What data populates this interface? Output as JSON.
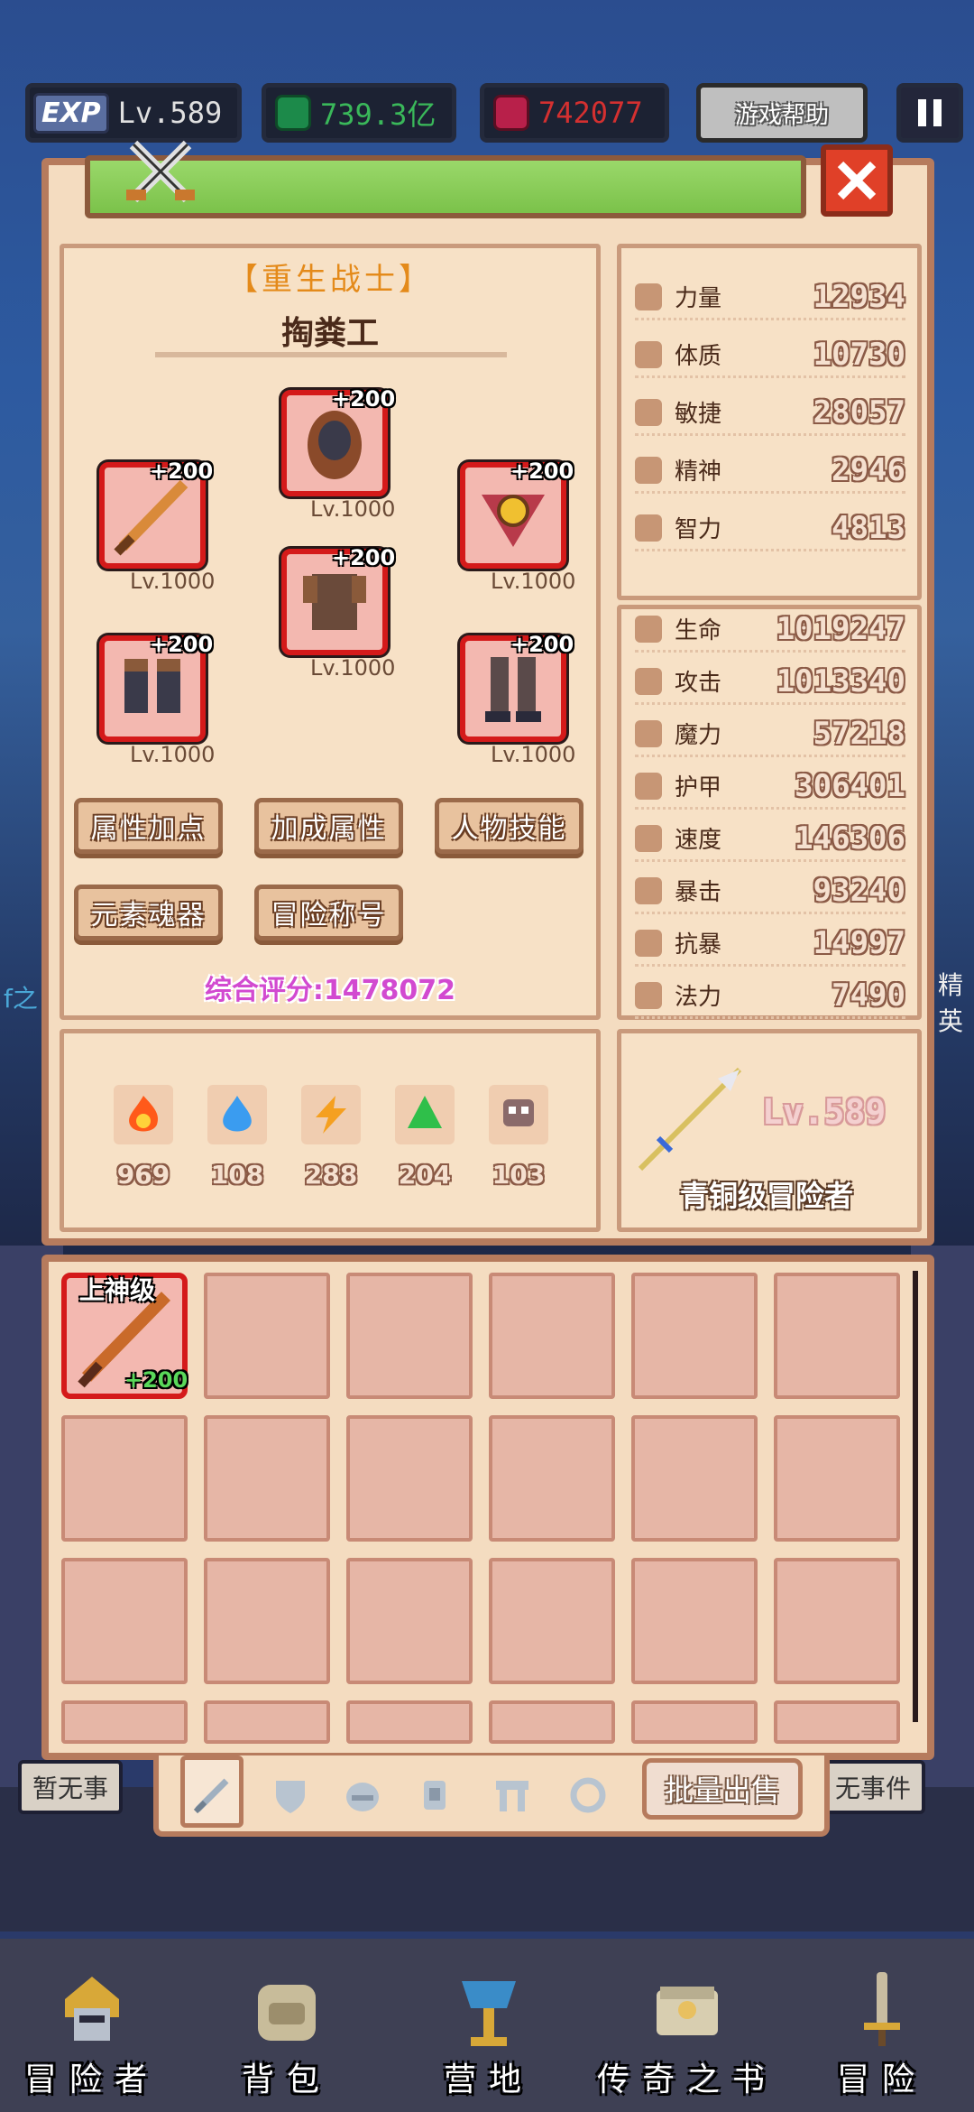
{
  "hud": {
    "exp_badge": "EXP",
    "level": "Lv.589",
    "gold": "739.3亿",
    "gems": "742077",
    "help": "游戏帮助"
  },
  "character": {
    "class_title": "【重生战士】",
    "name": "掏粪工",
    "score_label": "综合评分:",
    "score_value": "1478072"
  },
  "equipment": [
    {
      "plus": "+200",
      "level": "Lv.1000"
    },
    {
      "plus": "+200",
      "level": "Lv.1000"
    },
    {
      "plus": "+200",
      "level": "Lv.1000"
    },
    {
      "plus": "+200",
      "level": "Lv.1000"
    },
    {
      "plus": "+200",
      "level": "Lv.1000"
    },
    {
      "plus": "+200",
      "level": "Lv.1000"
    }
  ],
  "actions": {
    "attr_points": "属性加点",
    "bonus_attr": "加成属性",
    "char_skills": "人物技能",
    "element_soul": "元素魂器",
    "adventure_title": "冒险称号"
  },
  "base_stats": [
    {
      "label": "力量",
      "value": "12934",
      "icon": "strength-icon"
    },
    {
      "label": "体质",
      "value": "10730",
      "icon": "constitution-icon"
    },
    {
      "label": "敏捷",
      "value": "28057",
      "icon": "agility-icon"
    },
    {
      "label": "精神",
      "value": "2946",
      "icon": "spirit-icon"
    },
    {
      "label": "智力",
      "value": "4813",
      "icon": "intellect-icon"
    }
  ],
  "combat_stats": [
    {
      "label": "生命",
      "value": "1019247",
      "icon": "life-icon"
    },
    {
      "label": "攻击",
      "value": "1013340",
      "icon": "attack-icon"
    },
    {
      "label": "魔力",
      "value": "57218",
      "icon": "magic-icon"
    },
    {
      "label": "护甲",
      "value": "306401",
      "icon": "armor-icon"
    },
    {
      "label": "速度",
      "value": "146306",
      "icon": "speed-icon"
    },
    {
      "label": "暴击",
      "value": "93240",
      "icon": "crit-icon"
    },
    {
      "label": "抗暴",
      "value": "14997",
      "icon": "crit-resist-icon"
    },
    {
      "label": "法力",
      "value": "7490",
      "icon": "mana-icon"
    }
  ],
  "elements": [
    {
      "name": "fire-element-icon",
      "value": "969",
      "color": "#ff5a1a"
    },
    {
      "name": "water-element-icon",
      "value": "108",
      "color": "#3a9cf0"
    },
    {
      "name": "lightning-element-icon",
      "value": "288",
      "color": "#f5a020"
    },
    {
      "name": "earth-element-icon",
      "value": "204",
      "color": "#2fbf4a"
    },
    {
      "name": "dark-element-icon",
      "value": "103",
      "color": "#8a6a6a"
    }
  ],
  "rank": {
    "level": "Lv.589",
    "title": "青铜级冒险者"
  },
  "inventory": {
    "first_item_grade": "上神级",
    "first_item_plus": "+200",
    "sell_button": "批量出售"
  },
  "behind": {
    "left_event": "暂无事",
    "right_event": "无事件",
    "left_side": "E",
    "side_text_left": "f之",
    "side_text_right": "精英"
  },
  "nav": [
    {
      "label": "冒险者",
      "icon": "adventurer-icon"
    },
    {
      "label": "背包",
      "icon": "backpack-icon"
    },
    {
      "label": "营地",
      "icon": "camp-icon"
    },
    {
      "label": "传奇之书",
      "icon": "legend-book-icon"
    },
    {
      "label": "冒险",
      "icon": "adventure-icon"
    }
  ],
  "colors": {
    "panel_bg": "#f4dcc0",
    "panel_border": "#b67b5d",
    "equip_border": "#d41a1a",
    "score_color": "#d24ad0",
    "class_color": "#e48a1a"
  }
}
